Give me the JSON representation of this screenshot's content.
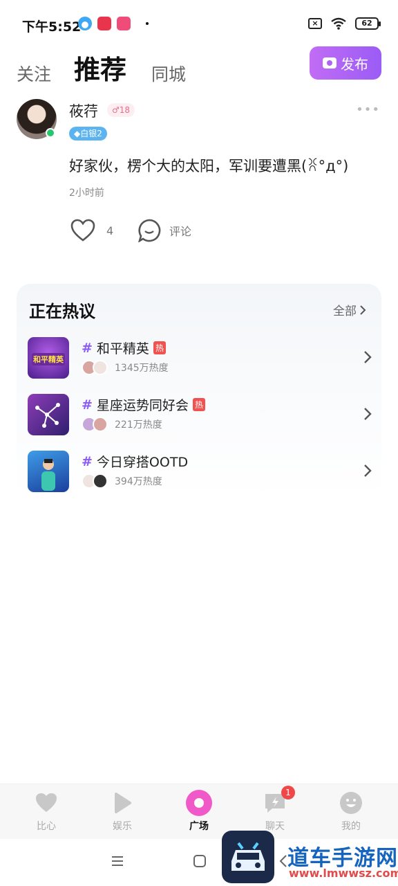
{
  "status_bar": {
    "time": "下午5:52",
    "battery": "62"
  },
  "tabs": {
    "follow": "关注",
    "recommend": "推荐",
    "city": "同城",
    "publish": "发布"
  },
  "post": {
    "username": "莜荇",
    "age_badge": "♂18",
    "level_badge": "◆白银2",
    "text": "好家伙，楞个大的太阳，军训要遭黑(ꐦ°д°)",
    "time": "2小时前",
    "likes": "4",
    "comment_label": "评论"
  },
  "hot": {
    "title": "正在热议",
    "all_label": "全部",
    "topics": [
      {
        "hash": "#",
        "name": "和平精英",
        "tag": "热",
        "heat": "1345万热度",
        "thumb_label": "和平精英"
      },
      {
        "hash": "#",
        "name": "星座运势同好会",
        "tag": "热",
        "heat": "221万热度"
      },
      {
        "hash": "#",
        "name": "今日穿搭OOTD",
        "tag": "",
        "heat": "394万热度"
      }
    ]
  },
  "bottom_nav": {
    "items": [
      {
        "label": "比心"
      },
      {
        "label": "娱乐"
      },
      {
        "label": "广场"
      },
      {
        "label": "聊天",
        "badge": "1"
      },
      {
        "label": "我的"
      }
    ]
  },
  "watermark": {
    "text": "道车手游网",
    "url": "www.lmwwsz.com"
  },
  "colors": {
    "accent_purple": "#9b5cf6",
    "active_pink": "#f05ac8",
    "hot_red": "#f0524f"
  }
}
